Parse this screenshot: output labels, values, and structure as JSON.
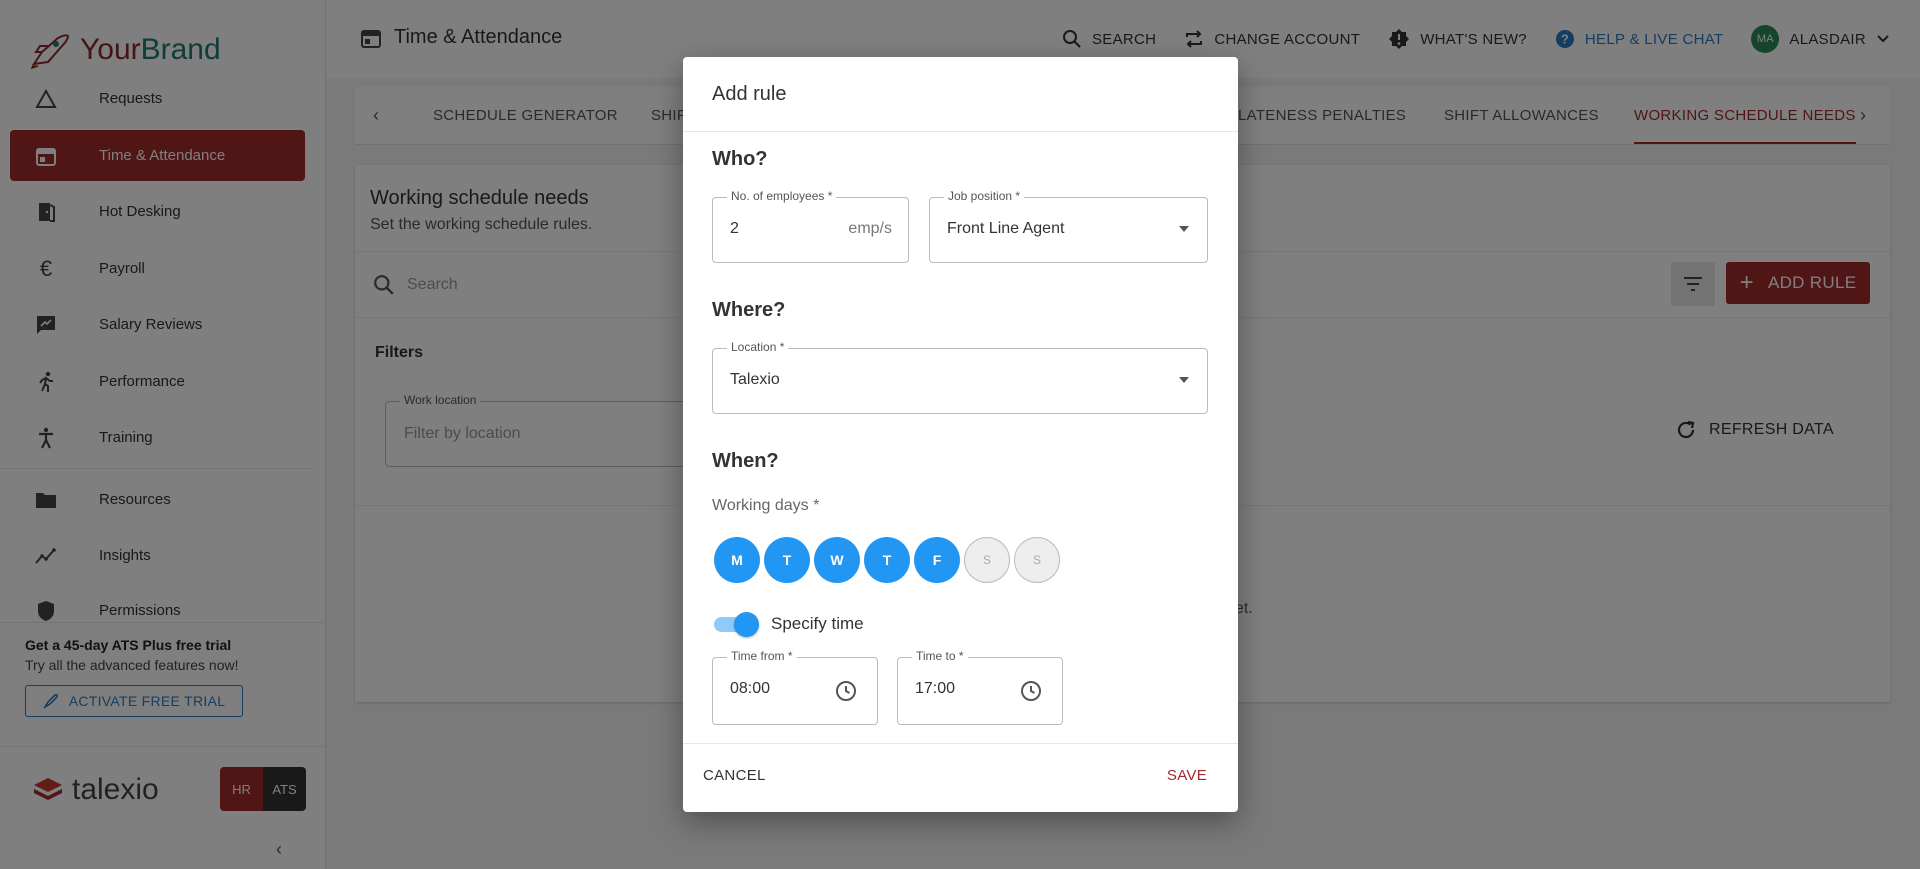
{
  "brand": {
    "name_part1": "Your",
    "name_part2": "Brand"
  },
  "sidebar": {
    "items": [
      {
        "label": "Requests"
      },
      {
        "label": "Time & Attendance"
      },
      {
        "label": "Hot Desking"
      },
      {
        "label": "Payroll"
      },
      {
        "label": "Salary Reviews"
      },
      {
        "label": "Performance"
      },
      {
        "label": "Training"
      },
      {
        "label": "Resources"
      },
      {
        "label": "Insights"
      },
      {
        "label": "Permissions"
      }
    ],
    "trial": {
      "title": "Get a 45-day ATS Plus free trial",
      "subtitle": "Try all the advanced features now!",
      "button": "ACTIVATE FREE TRIAL"
    },
    "footer": {
      "logo_text": "talexio",
      "hr": "HR",
      "ats": "ATS"
    }
  },
  "header": {
    "title": "Time & Attendance",
    "search": "SEARCH",
    "change_account": "CHANGE ACCOUNT",
    "whats_new": "WHAT'S NEW?",
    "help": "HELP & LIVE CHAT",
    "avatar_initials": "MA",
    "user": "ALASDAIR"
  },
  "tabs": [
    {
      "label": "SCHEDULE GENERATOR"
    },
    {
      "label": "SHIF"
    },
    {
      "label": "LATENESS PENALTIES"
    },
    {
      "label": "SHIFT ALLOWANCES"
    },
    {
      "label": "WORKING SCHEDULE NEEDS"
    }
  ],
  "main": {
    "title": "Working schedule needs",
    "subtitle": "Set the working schedule rules.",
    "search_placeholder": "Search",
    "add_rule": "ADD RULE",
    "filters": "Filters",
    "work_location_label": "Work location",
    "work_location_placeholder": "Filter by location",
    "refresh": "REFRESH DATA",
    "empty_fragment": "et."
  },
  "dialog": {
    "title": "Add rule",
    "who": "Who?",
    "employees_label": "No. of employees *",
    "employees_value": "2",
    "employees_suffix": "emp/s",
    "job_label": "Job position *",
    "job_value": "Front Line Agent",
    "where": "Where?",
    "location_label": "Location *",
    "location_value": "Talexio",
    "when": "When?",
    "working_days_label": "Working days *",
    "days": [
      {
        "letter": "M",
        "selected": true
      },
      {
        "letter": "T",
        "selected": true
      },
      {
        "letter": "W",
        "selected": true
      },
      {
        "letter": "T",
        "selected": true
      },
      {
        "letter": "F",
        "selected": true
      },
      {
        "letter": "S",
        "selected": false
      },
      {
        "letter": "S",
        "selected": false
      }
    ],
    "specify_time_label": "Specify time",
    "specify_time_on": true,
    "time_from_label": "Time from *",
    "time_from_value": "08:00",
    "time_to_label": "Time to *",
    "time_to_value": "17:00",
    "cancel": "CANCEL",
    "save": "SAVE"
  },
  "colors": {
    "accent": "#a12b2b",
    "primary_blue": "#2196f3",
    "help_blue": "#2b78c2"
  }
}
